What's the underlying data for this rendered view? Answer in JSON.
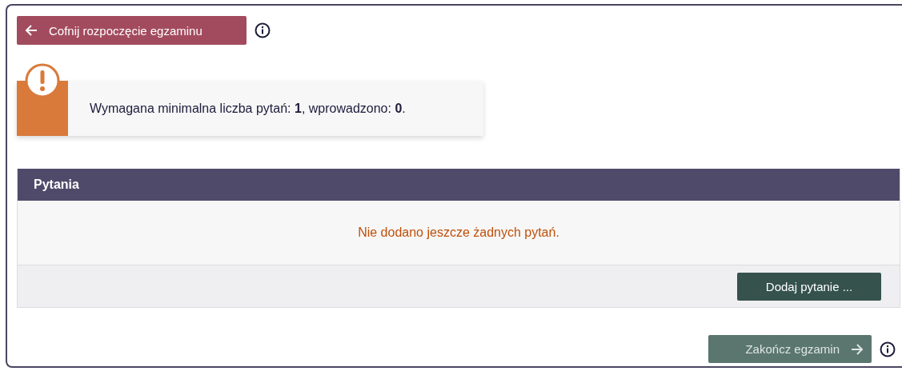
{
  "back_button": {
    "label": "Cofnij rozpoczęcie egzaminu"
  },
  "alert": {
    "message": "Wymagana minimalna liczba pytań: **1**, wprowadzono: **0**."
  },
  "questions_panel": {
    "title": "Pytania",
    "empty_message": "Nie dodano jeszcze żadnych pytań.",
    "add_button": {
      "label": "Dodaj pytanie ..."
    }
  },
  "finish_button": {
    "label": "Zakończ egzamin",
    "disabled": true
  }
}
